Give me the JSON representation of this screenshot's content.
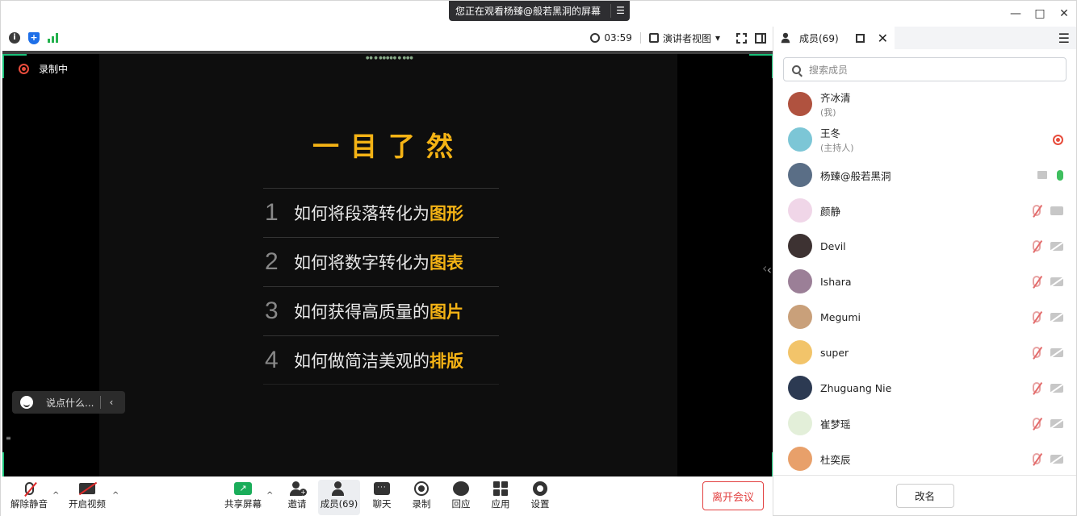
{
  "banner": {
    "text": "您正在观看杨臻@般若黑洞的屏幕",
    "menu_icon": "list-icon"
  },
  "window": {
    "minimize": "—",
    "maximize": "□",
    "close": "✕"
  },
  "meeting_bar": {
    "info": "i",
    "shield": "+",
    "timer": "03:59",
    "view_label": "演讲者视图",
    "view_caret": "▾"
  },
  "stage": {
    "recording_label": "录制中",
    "top_indicator": "●● ● ●●●●● ● ●●●",
    "chat_placeholder": "说点什么...",
    "chat_arrow": "‹",
    "collapse_arrow": "‹",
    "left_mark": "≡"
  },
  "slide": {
    "title": "一目了然",
    "items": [
      {
        "num": "1",
        "text": "如何将段落转化为",
        "highlight": "图形"
      },
      {
        "num": "2",
        "text": "如何将数字转化为",
        "highlight": "图表"
      },
      {
        "num": "3",
        "text": "如何获得高质量的",
        "highlight": "图片"
      },
      {
        "num": "4",
        "text": "如何做简洁美观的",
        "highlight": "排版"
      }
    ]
  },
  "toolbar": {
    "unmute": "解除静音",
    "start_video": "开启视频",
    "share": "共享屏幕",
    "invite": "邀请",
    "participants": "成员(69)",
    "chat": "聊天",
    "record": "录制",
    "react": "回应",
    "apps": "应用",
    "settings": "设置",
    "leave": "离开会议",
    "caret": "^"
  },
  "panel": {
    "tab_label": "成员(69)",
    "close": "✕",
    "menu": "☰",
    "search_placeholder": "搜索成员",
    "members": [
      {
        "name": "齐冰清",
        "sub": "(我)",
        "avatar_color": "#b0523f",
        "icons": []
      },
      {
        "name": "王冬",
        "sub": "(主持人)",
        "avatar_color": "#7cc6d6",
        "icons": [
          "rec"
        ]
      },
      {
        "name": "杨臻@般若黑洞",
        "sub": "",
        "avatar_color": "#5a6e86",
        "icons": [
          "screen",
          "mic-on"
        ]
      },
      {
        "name": "颜静",
        "sub": "",
        "avatar_color": "#f0d6e8",
        "icons": [
          "mic-off",
          "cam"
        ]
      },
      {
        "name": "Devil",
        "sub": "",
        "avatar_color": "#3d3232",
        "icons": [
          "mic-off",
          "cam-off"
        ]
      },
      {
        "name": "Ishara",
        "sub": "",
        "avatar_color": "#9b7f97",
        "icons": [
          "mic-off",
          "cam-off"
        ]
      },
      {
        "name": "Megumi",
        "sub": "",
        "avatar_color": "#c9a07a",
        "icons": [
          "mic-off",
          "cam-off"
        ]
      },
      {
        "name": "super",
        "sub": "",
        "avatar_color": "#f2c46a",
        "icons": [
          "mic-off",
          "cam-off"
        ]
      },
      {
        "name": "Zhuguang Nie",
        "sub": "",
        "avatar_color": "#2c3a52",
        "icons": [
          "mic-off",
          "cam-off"
        ]
      },
      {
        "name": "崔梦瑶",
        "sub": "",
        "avatar_color": "#e3efd9",
        "icons": [
          "mic-off",
          "cam-off"
        ]
      },
      {
        "name": "杜奕辰",
        "sub": "",
        "avatar_color": "#e8a06a",
        "icons": [
          "mic-off",
          "cam-off"
        ]
      }
    ],
    "rename": "改名",
    "collapse_arrow": "‹"
  }
}
